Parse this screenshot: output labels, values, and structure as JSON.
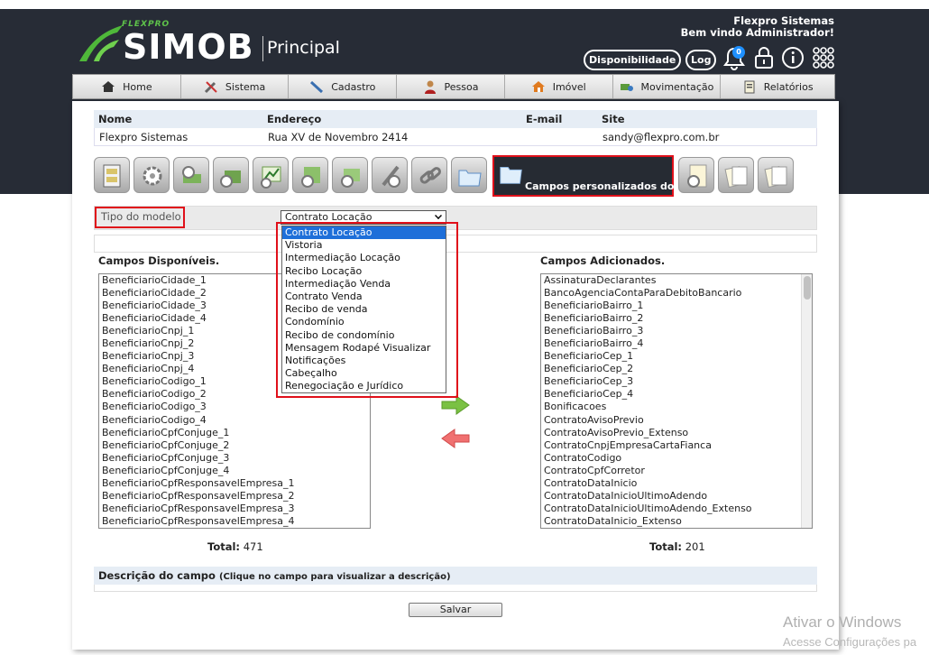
{
  "header": {
    "logo_brand": "FLEXPRO",
    "logo_name": "SIMOB",
    "module": "Principal",
    "company": "Flexpro Sistemas",
    "welcome": "Bem vindo Administrador!",
    "btn_disponibilidade": "Disponibilidade",
    "btn_log": "Log",
    "notification_count": "0"
  },
  "nav": [
    {
      "label": "Home",
      "icon": "home-icon"
    },
    {
      "label": "Sistema",
      "icon": "tools-icon"
    },
    {
      "label": "Cadastro",
      "icon": "pencil-icon"
    },
    {
      "label": "Pessoa",
      "icon": "person-icon"
    },
    {
      "label": "Imóvel",
      "icon": "house-icon"
    },
    {
      "label": "Movimentação",
      "icon": "money-icon"
    },
    {
      "label": "Relatórios",
      "icon": "report-icon"
    }
  ],
  "info": {
    "headers": [
      "Nome",
      "Endereço",
      "E-mail",
      "Site"
    ],
    "values": [
      "Flexpro Sistemas",
      "Rua XV de Novembro 2414",
      "",
      "sandy@flexpro.com.br"
    ]
  },
  "tabs": {
    "active_label": "Campos personalizados dos"
  },
  "form": {
    "tipo_label": "Tipo do modelo",
    "selected": "Contrato Locação",
    "options": [
      "Contrato Locação",
      "Vistoria",
      "Intermediação Locação",
      "Recibo Locação",
      "Intermediação Venda",
      "Contrato Venda",
      "Recibo de venda",
      "Condomínio",
      "Recibo de condomínio",
      "Mensagem Rodapé Visualizar",
      "Notificações",
      "Cabeçalho",
      "Renegociação e Jurídico"
    ]
  },
  "available": {
    "title": "Campos Disponíveis.",
    "items": [
      "BeneficiarioCidade_1",
      "BeneficiarioCidade_2",
      "BeneficiarioCidade_3",
      "BeneficiarioCidade_4",
      "BeneficiarioCnpj_1",
      "BeneficiarioCnpj_2",
      "BeneficiarioCnpj_3",
      "BeneficiarioCnpj_4",
      "BeneficiarioCodigo_1",
      "BeneficiarioCodigo_2",
      "BeneficiarioCodigo_3",
      "BeneficiarioCodigo_4",
      "BeneficiarioCpfConjuge_1",
      "BeneficiarioCpfConjuge_2",
      "BeneficiarioCpfConjuge_3",
      "BeneficiarioCpfConjuge_4",
      "BeneficiarioCpfResponsavelEmpresa_1",
      "BeneficiarioCpfResponsavelEmpresa_2",
      "BeneficiarioCpfResponsavelEmpresa_3",
      "BeneficiarioCpfResponsavelEmpresa_4"
    ],
    "total_label": "Total:",
    "total": "471"
  },
  "added": {
    "title": "Campos Adicionados.",
    "items": [
      "AssinaturaDeclarantes",
      "BancoAgenciaContaParaDebitoBancario",
      "BeneficiarioBairro_1",
      "BeneficiarioBairro_2",
      "BeneficiarioBairro_3",
      "BeneficiarioBairro_4",
      "BeneficiarioCep_1",
      "BeneficiarioCep_2",
      "BeneficiarioCep_3",
      "BeneficiarioCep_4",
      "Bonificacoes",
      "ContratoAvisoPrevio",
      "ContratoAvisoPrevio_Extenso",
      "ContratoCnpjEmpresaCartaFianca",
      "ContratoCodigo",
      "ContratoCpfCorretor",
      "ContratoDataInicio",
      "ContratoDataInicioUltimoAdendo",
      "ContratoDataInicioUltimoAdendo_Extenso",
      "ContratoDataInicio_Extenso"
    ],
    "total_label": "Total:",
    "total": "201"
  },
  "description": {
    "title": "Descrição do campo",
    "hint": "(Clique no campo para visualizar a descrição)"
  },
  "save_label": "Salvar",
  "watermark": {
    "line1": "Ativar o Windows",
    "line2": "Acesse Configurações pa"
  }
}
